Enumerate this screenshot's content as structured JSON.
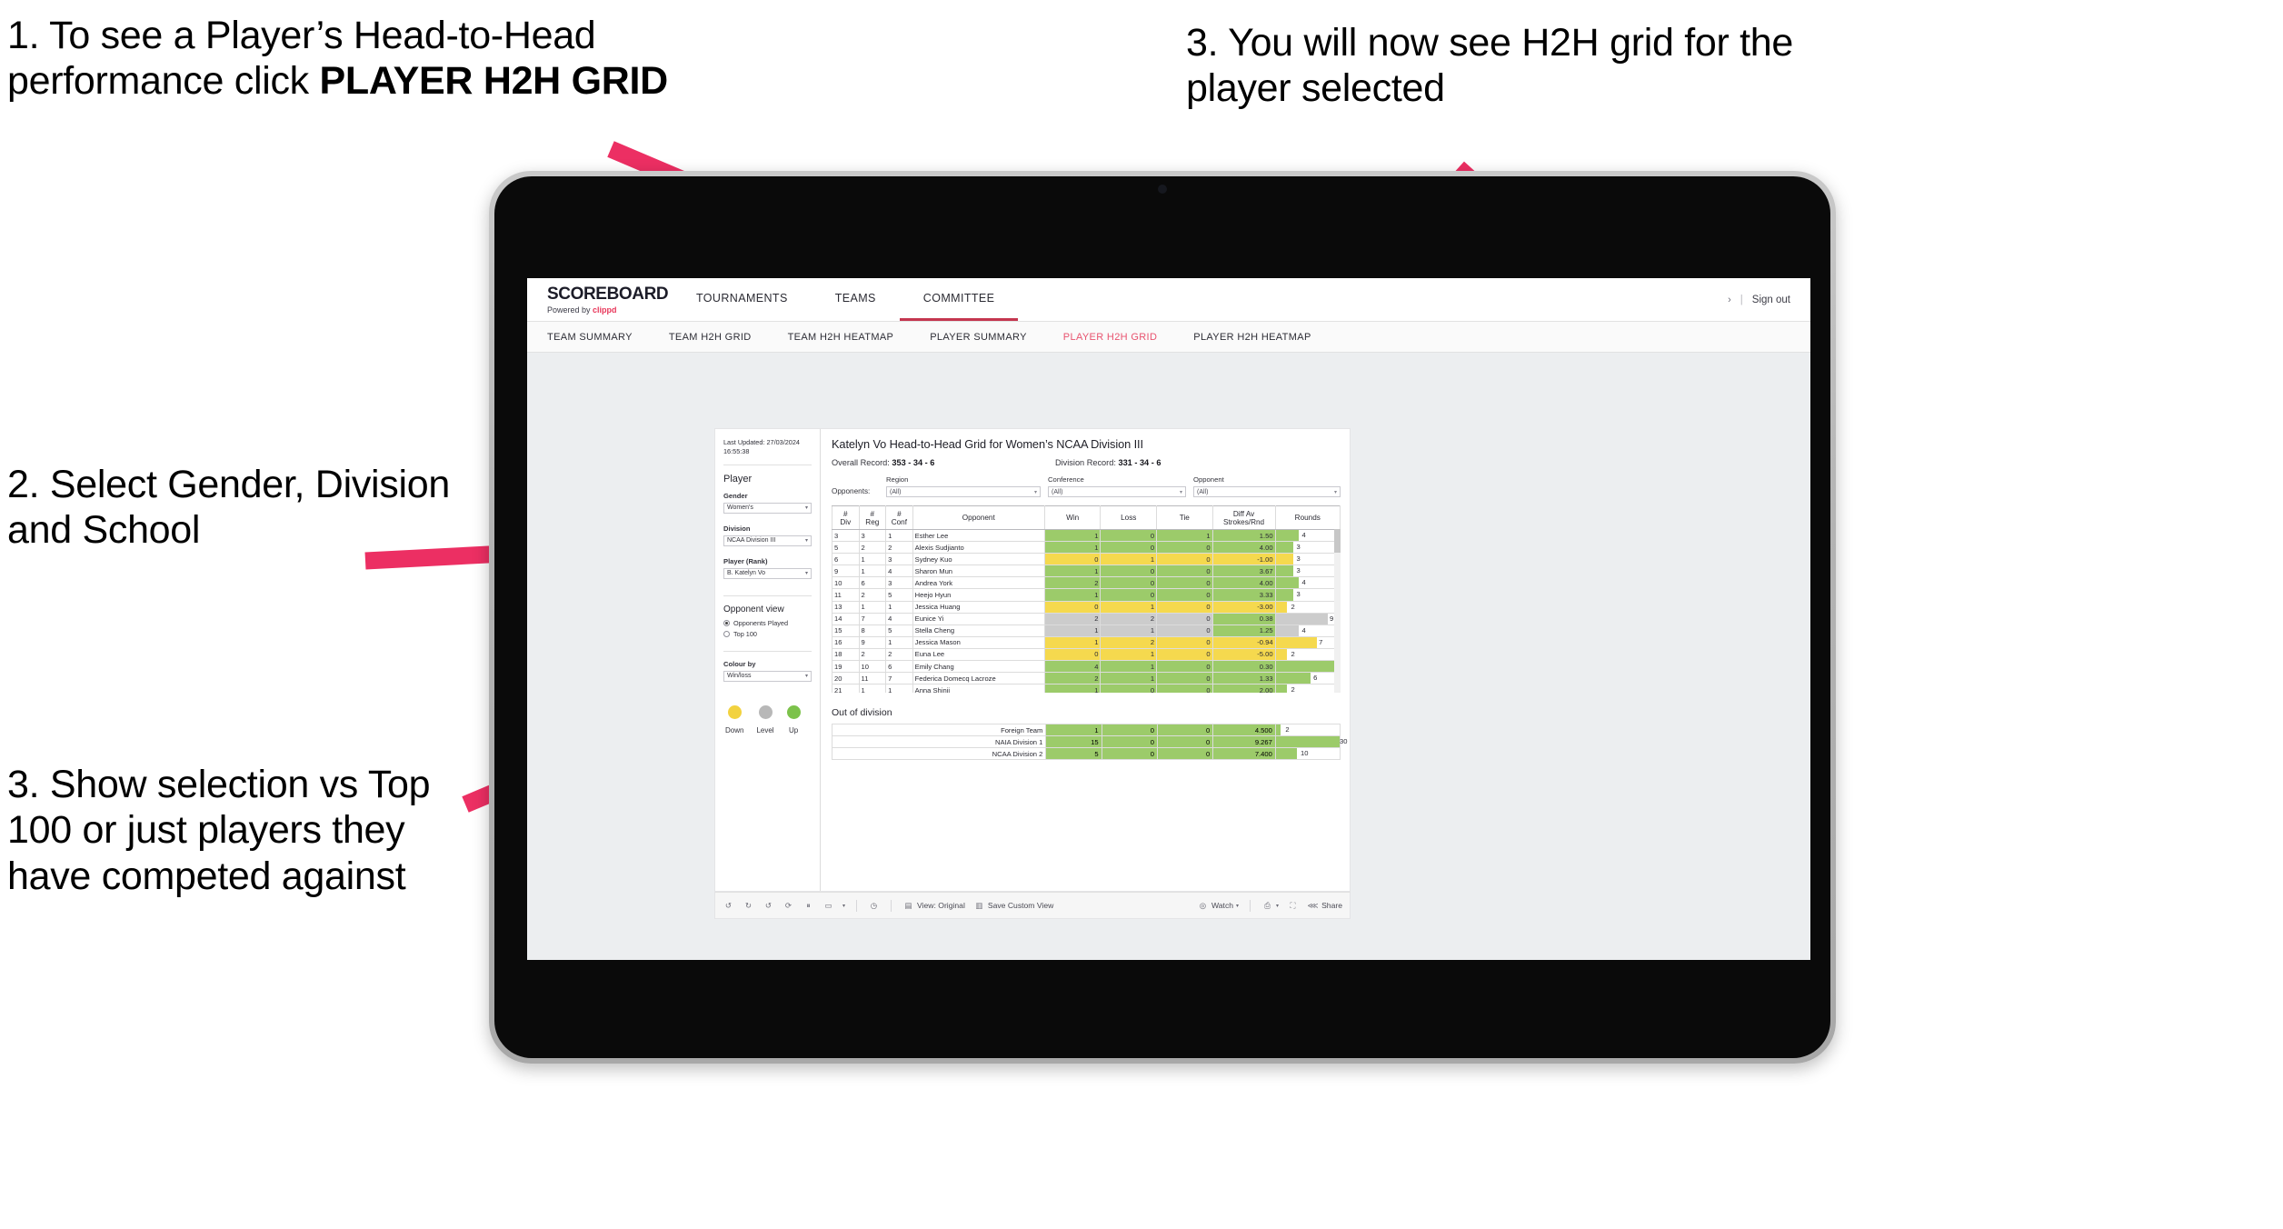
{
  "annotations": [
    {
      "id": "a1",
      "text_plain": "1. To see a Player’s Head-to-Head performance click ",
      "text_bold": "PLAYER H2H GRID"
    },
    {
      "id": "a2",
      "text": "2. Select Gender, Division and School"
    },
    {
      "id": "a3",
      "text": "3. Show selection vs Top 100 or just players they have competed against"
    },
    {
      "id": "a4",
      "text": "3. You will now see H2H grid for the player selected"
    }
  ],
  "colors": {
    "arrow": "#ec2f63",
    "accent_pink": "#e8536f",
    "brand_pink": "#e8375a",
    "green": "#92d14f",
    "green_soft": "#9ccb6a",
    "yellow": "#f5d94e",
    "grey": "#c8c8c8"
  },
  "header": {
    "brand_title": "SCOREBOARD",
    "brand_sub_prefix": "Powered by ",
    "brand_sub_brand": "clippd",
    "nav": [
      {
        "label": "TOURNAMENTS",
        "active": false
      },
      {
        "label": "TEAMS",
        "active": false
      },
      {
        "label": "COMMITTEE",
        "active": true
      }
    ],
    "chevron": "›",
    "separator": "|",
    "sign_out": "Sign out"
  },
  "subnav": [
    {
      "label": "TEAM SUMMARY",
      "active": false
    },
    {
      "label": "TEAM H2H GRID",
      "active": false
    },
    {
      "label": "TEAM H2H HEATMAP",
      "active": false
    },
    {
      "label": "PLAYER SUMMARY",
      "active": false
    },
    {
      "label": "PLAYER H2H GRID",
      "active": true
    },
    {
      "label": "PLAYER H2H HEATMAP",
      "active": false
    }
  ],
  "sidebar": {
    "last_updated": "Last Updated: 27/03/2024 16:55:38",
    "player_heading": "Player",
    "fields": [
      {
        "label": "Gender",
        "value": "Women's"
      },
      {
        "label": "Division",
        "value": "NCAA Division III"
      },
      {
        "label": "Player (Rank)",
        "value": "B. Katelyn Vo"
      }
    ],
    "opponent_view_heading": "Opponent view",
    "opponent_view_options": [
      {
        "label": "Opponents Played",
        "selected": true
      },
      {
        "label": "Top 100",
        "selected": false
      }
    ],
    "colour_by_label": "Colour by",
    "colour_by_value": "Win/loss",
    "legend": [
      {
        "label": "Down",
        "color": "#f2d23f"
      },
      {
        "label": "Level",
        "color": "#b8b8b8"
      },
      {
        "label": "Up",
        "color": "#7cc24b"
      }
    ]
  },
  "main": {
    "title": "Katelyn Vo Head-to-Head Grid for Women’s NCAA Division III",
    "overall_record_label": "Overall Record:",
    "overall_record_value": "353 - 34 - 6",
    "division_record_label": "Division Record:",
    "division_record_value": "331 - 34 - 6",
    "opponents_label": "Opponents:",
    "filters": [
      {
        "caption": "Region",
        "value": "(All)"
      },
      {
        "caption": "Conference",
        "value": "(All)"
      },
      {
        "caption": "Opponent",
        "value": "(All)"
      }
    ],
    "grid_headers": {
      "div": "#\nDiv",
      "div_l1": "#",
      "div_l2": "Div",
      "reg_l1": "#",
      "reg_l2": "Reg",
      "conf_l1": "#",
      "conf_l2": "Conf",
      "opponent": "Opponent",
      "win": "Win",
      "loss": "Loss",
      "tie": "Tie",
      "diff_l1": "Diff Av",
      "diff_l2": "Strokes/Rnd",
      "rounds": "Rounds"
    },
    "out_of_division_title": "Out of division"
  },
  "chart_data": {
    "type": "table",
    "title": "Katelyn Vo Head-to-Head Grid for Women’s NCAA Division III",
    "columns": [
      "# Div",
      "# Reg",
      "# Conf",
      "Opponent",
      "Win",
      "Loss",
      "Tie",
      "Diff Av Strokes/Rnd",
      "Rounds"
    ],
    "rows": [
      {
        "div": "3",
        "reg": "3",
        "conf": "1",
        "opponent": "Esther Lee",
        "win": "1",
        "loss": "0",
        "tie": "1",
        "diff": "1.50",
        "rounds": "4",
        "color": "green",
        "bar_pct": 36
      },
      {
        "div": "5",
        "reg": "2",
        "conf": "2",
        "opponent": "Alexis Sudjianto",
        "win": "1",
        "loss": "0",
        "tie": "0",
        "diff": "4.00",
        "rounds": "3",
        "color": "green",
        "bar_pct": 27
      },
      {
        "div": "6",
        "reg": "1",
        "conf": "3",
        "opponent": "Sydney Kuo",
        "win": "0",
        "loss": "1",
        "tie": "0",
        "diff": "-1.00",
        "rounds": "3",
        "color": "yellow",
        "bar_pct": 27
      },
      {
        "div": "9",
        "reg": "1",
        "conf": "4",
        "opponent": "Sharon Mun",
        "win": "1",
        "loss": "0",
        "tie": "0",
        "diff": "3.67",
        "rounds": "3",
        "color": "green",
        "bar_pct": 27
      },
      {
        "div": "10",
        "reg": "6",
        "conf": "3",
        "opponent": "Andrea York",
        "win": "2",
        "loss": "0",
        "tie": "0",
        "diff": "4.00",
        "rounds": "4",
        "color": "green",
        "bar_pct": 36
      },
      {
        "div": "11",
        "reg": "2",
        "conf": "5",
        "opponent": "Heejo Hyun",
        "win": "1",
        "loss": "0",
        "tie": "0",
        "diff": "3.33",
        "rounds": "3",
        "color": "green",
        "bar_pct": 27
      },
      {
        "div": "13",
        "reg": "1",
        "conf": "1",
        "opponent": "Jessica Huang",
        "win": "0",
        "loss": "1",
        "tie": "0",
        "diff": "-3.00",
        "rounds": "2",
        "color": "yellow",
        "bar_pct": 18
      },
      {
        "div": "14",
        "reg": "7",
        "conf": "4",
        "opponent": "Eunice Yi",
        "win": "2",
        "loss": "2",
        "tie": "0",
        "diff": "0.38",
        "rounds": "9",
        "color": "grey",
        "bar_pct": 82,
        "diff_color": "green"
      },
      {
        "div": "15",
        "reg": "8",
        "conf": "5",
        "opponent": "Stella Cheng",
        "win": "1",
        "loss": "1",
        "tie": "0",
        "diff": "1.25",
        "rounds": "4",
        "color": "grey",
        "bar_pct": 36,
        "diff_color": "green"
      },
      {
        "div": "16",
        "reg": "9",
        "conf": "1",
        "opponent": "Jessica Mason",
        "win": "1",
        "loss": "2",
        "tie": "0",
        "diff": "-0.94",
        "rounds": "7",
        "color": "yellow",
        "bar_pct": 64
      },
      {
        "div": "18",
        "reg": "2",
        "conf": "2",
        "opponent": "Euna Lee",
        "win": "0",
        "loss": "1",
        "tie": "0",
        "diff": "-5.00",
        "rounds": "2",
        "color": "yellow",
        "bar_pct": 18
      },
      {
        "div": "19",
        "reg": "10",
        "conf": "6",
        "opponent": "Emily Chang",
        "win": "4",
        "loss": "1",
        "tie": "0",
        "diff": "0.30",
        "rounds": "11",
        "color": "green",
        "bar_pct": 100
      },
      {
        "div": "20",
        "reg": "11",
        "conf": "7",
        "opponent": "Federica Domecq Lacroze",
        "win": "2",
        "loss": "1",
        "tie": "0",
        "diff": "1.33",
        "rounds": "6",
        "color": "green",
        "bar_pct": 55
      }
    ],
    "out_of_division": [
      {
        "name": "Foreign Team",
        "win": "1",
        "loss": "0",
        "tie": "0",
        "diff": "4.500",
        "rounds": "2",
        "color": "green",
        "bar_pct": 7
      },
      {
        "name": "NAIA Division 1",
        "win": "15",
        "loss": "0",
        "tie": "0",
        "diff": "9.267",
        "rounds": "30",
        "color": "green",
        "bar_pct": 100
      },
      {
        "name": "NCAA Division 2",
        "win": "5",
        "loss": "0",
        "tie": "0",
        "diff": "7.400",
        "rounds": "10",
        "color": "green",
        "bar_pct": 33
      }
    ],
    "legend": [
      {
        "label": "Down",
        "color": "#f2d23f"
      },
      {
        "label": "Level",
        "color": "#b8b8b8"
      },
      {
        "label": "Up",
        "color": "#7cc24b"
      }
    ]
  },
  "toolbar": {
    "undo": "undo-icon",
    "redo": "redo-icon",
    "revert": "revert-icon",
    "refresh": "refresh-icon",
    "pause": "pause-icon",
    "alerts": "alerts-icon",
    "view_label": "View: Original",
    "save_custom_view": "Save Custom View",
    "watch": "Watch",
    "share": "Share"
  }
}
